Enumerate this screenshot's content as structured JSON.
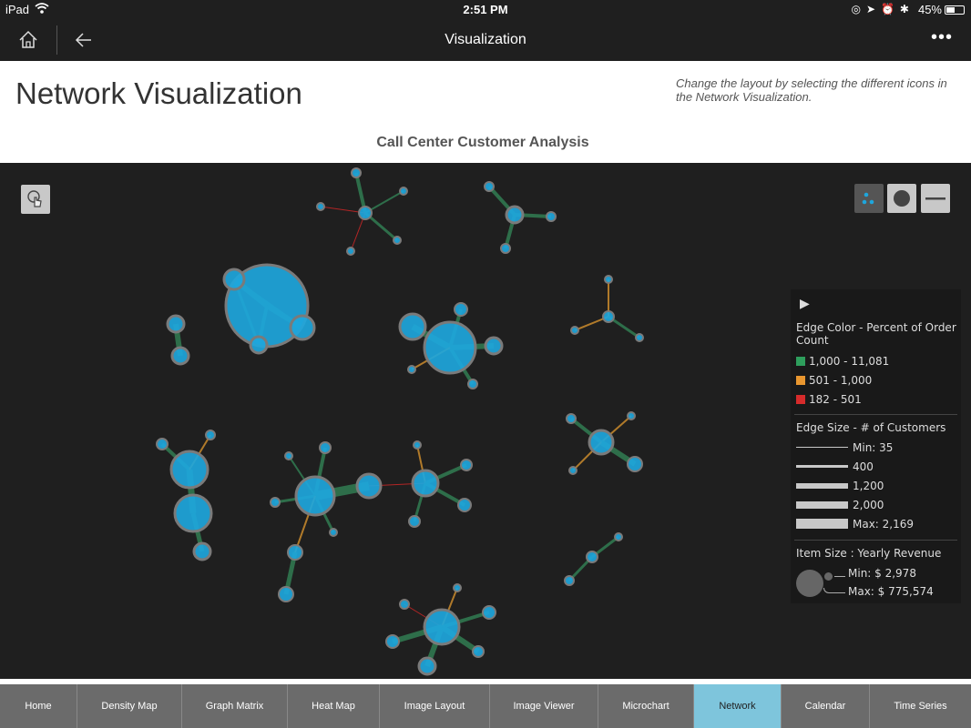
{
  "status_bar": {
    "device": "iPad",
    "time": "2:51 PM",
    "battery": "45%"
  },
  "nav": {
    "title": "Visualization",
    "more": "•••"
  },
  "header": {
    "page_title": "Network Visualization",
    "hint": "Change the layout by selecting the different icons in the Network Visualization.",
    "viz_title": "Call Center Customer Analysis"
  },
  "legend": {
    "edge_color_title": "Edge Color - Percent of Order Count",
    "edge_colors": [
      {
        "label": "1,000 - 11,081",
        "color": "#2e9e5c"
      },
      {
        "label": "501 - 1,000",
        "color": "#e8962f"
      },
      {
        "label": "182 - 501",
        "color": "#d62b2b"
      }
    ],
    "edge_size_title": "Edge Size - # of Customers",
    "edge_sizes": [
      {
        "label": "Min: 35",
        "value": 35
      },
      {
        "label": "400",
        "value": 400
      },
      {
        "label": "1,200",
        "value": 1200
      },
      {
        "label": "2,000",
        "value": 2000
      },
      {
        "label": "Max: 2,169",
        "value": 2169
      }
    ],
    "item_size_title": "Item Size : Yearly Revenue",
    "item_min": "Min: $  2,978",
    "item_max": "Max: $  775,574"
  },
  "colors": {
    "node_fill": "#1ea6dc",
    "node_stroke": "#7a7a7a",
    "edge_high": "#2e6e4a",
    "edge_mid": "#b07a2a",
    "edge_low": "#b32525",
    "active_tab": "#7ec5dc"
  },
  "tabs": [
    {
      "label": "Home",
      "active": false
    },
    {
      "label": "Density Map",
      "active": false
    },
    {
      "label": "Graph Matrix",
      "active": false
    },
    {
      "label": "Heat Map",
      "active": false
    },
    {
      "label": "Image Layout",
      "active": false
    },
    {
      "label": "Image Viewer",
      "active": false
    },
    {
      "label": "Microchart",
      "active": false
    },
    {
      "label": "Network",
      "active": true
    },
    {
      "label": "Calendar",
      "active": false
    },
    {
      "label": "Time Series",
      "active": false
    }
  ]
}
